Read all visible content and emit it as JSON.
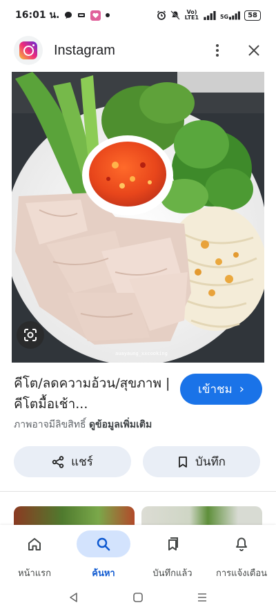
{
  "status_bar": {
    "time": "16:01 น.",
    "network_top": "Vo) LTE1",
    "net_5g": "5G",
    "battery": "58"
  },
  "header": {
    "title": "Instagram",
    "logo_icon": "instagram-logo",
    "more_icon": "more-vert-icon",
    "close_icon": "close-icon"
  },
  "image": {
    "watermark": "auayaung_xxcooking",
    "lens_icon": "google-lens-icon"
  },
  "result": {
    "title": "คีโต/ลดความอ้วน/สุขภาพ | คีโตมื้อเช้า...",
    "visit_label": "เข้าชม",
    "rights_text": "ภาพอาจมีลิขสิทธิ์",
    "more_info": "ดูข้อมูลเพิ่มเติม"
  },
  "actions": {
    "share_label": "แชร์",
    "save_label": "บันทึก"
  },
  "bottom_nav": {
    "items": [
      {
        "label": "หน้าแรก",
        "icon": "home-icon",
        "active": false
      },
      {
        "label": "ค้นหา",
        "icon": "search-icon",
        "active": true
      },
      {
        "label": "บันทึกแล้ว",
        "icon": "saved-bookmarks-icon",
        "active": false
      },
      {
        "label": "การแจ้งเตือน",
        "icon": "bell-icon",
        "active": false
      }
    ]
  },
  "colors": {
    "accent": "#1a73e8",
    "pill_bg": "#e9eef6",
    "active_nav_bg": "#d3e3fd",
    "active_nav_text": "#0b57d0"
  }
}
